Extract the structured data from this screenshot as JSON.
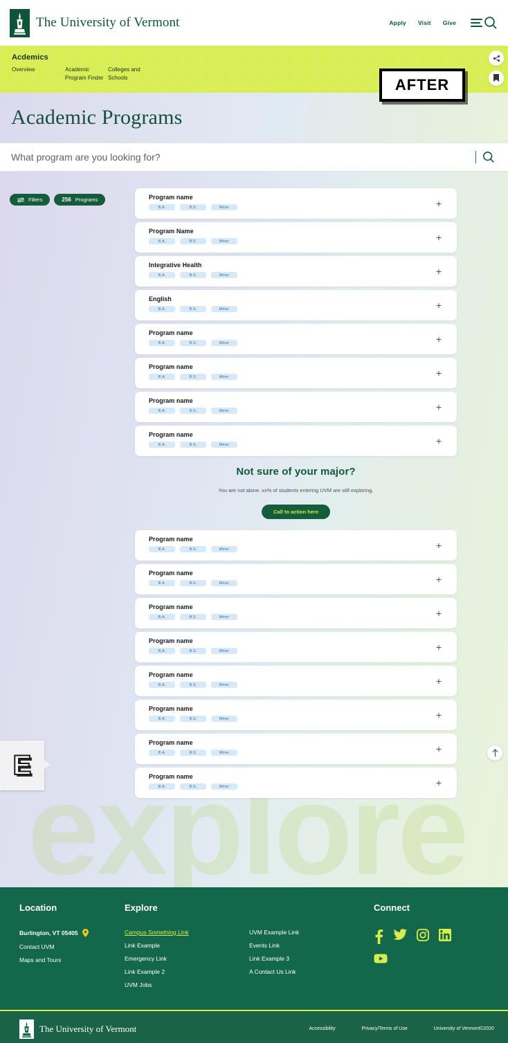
{
  "header": {
    "brand": "The University of Vermont",
    "nav": [
      {
        "label": "Apply"
      },
      {
        "label": "Visit"
      },
      {
        "label": "Give"
      }
    ],
    "menu_icon": "hamburger-icon",
    "search_icon": "search-icon"
  },
  "subnav": {
    "title": "Acdemics",
    "links": [
      {
        "label": "Overview"
      },
      {
        "label": "Academic Program Finder"
      },
      {
        "label": "Colleges and Schools"
      }
    ],
    "share_icon": "share-icon",
    "bookmark_icon": "bookmark-icon",
    "bg_color": "#d6ed4d"
  },
  "annotation": {
    "after_label": "AFTER",
    "comment_marker": "E"
  },
  "hero": {
    "title": "Academic Programs"
  },
  "search": {
    "placeholder": "What program are you looking for?",
    "value": "",
    "icon": "search-icon"
  },
  "toolbar": {
    "filters_label": "Filters",
    "filters_icon": "sliders-icon",
    "count": "256",
    "count_label": "Programs"
  },
  "watermark": "explore",
  "program_tags": [
    "B.A.",
    "B.S.",
    "Minor"
  ],
  "expand_icon": "plus-icon",
  "programs_top": [
    {
      "name": "Program name"
    },
    {
      "name": "Program Name"
    },
    {
      "name": "Integrative Health"
    },
    {
      "name": "English"
    },
    {
      "name": "Program name"
    },
    {
      "name": "Program name"
    },
    {
      "name": "Program name"
    },
    {
      "name": "Program name"
    }
  ],
  "cta": {
    "heading": "Not sure of your major?",
    "text": "You are not alone. xx% of students entering UVM are still exploring.",
    "button": "Call to action here",
    "button_bg": "#155c3c",
    "button_color": "#c9e84b"
  },
  "programs_bottom": [
    {
      "name": "Program name"
    },
    {
      "name": "Program name"
    },
    {
      "name": "Program name"
    },
    {
      "name": "Program name"
    },
    {
      "name": "Program name"
    },
    {
      "name": "Program name"
    },
    {
      "name": "Program name"
    },
    {
      "name": "Program name"
    }
  ],
  "back_to_top_icon": "arrow-up-icon",
  "footer": {
    "location": {
      "heading": "Location",
      "address": "Burlington, VT 05405",
      "pin_icon": "map-pin-icon",
      "links": [
        {
          "label": "Contact UVM"
        },
        {
          "label": "Maps and Tours"
        }
      ]
    },
    "explore": {
      "heading": "Explore",
      "links_col1": [
        {
          "label": "Campus Something Link",
          "highlight": true
        },
        {
          "label": "Link Example",
          "highlight": false
        },
        {
          "label": "Emergency Link",
          "highlight": false
        },
        {
          "label": "Link Example 2",
          "highlight": false
        },
        {
          "label": "UVM Jobs",
          "highlight": false
        }
      ],
      "links_col2": [
        {
          "label": "UVM Example Link"
        },
        {
          "label": "Events Link"
        },
        {
          "label": "Link Example 3"
        },
        {
          "label": "A Contact Us Link"
        }
      ]
    },
    "connect": {
      "heading": "Connect",
      "socials": [
        {
          "name": "facebook-icon"
        },
        {
          "name": "twitter-icon"
        },
        {
          "name": "instagram-icon"
        },
        {
          "name": "linkedin-icon"
        },
        {
          "name": "youtube-icon"
        }
      ]
    },
    "accent_color": "#d6ed4d",
    "bg_color": "#13674a"
  },
  "bottombar": {
    "brand": "The University of Vermont",
    "links": [
      {
        "label": "Accessibility"
      },
      {
        "label": "Privacy/Terms of Use"
      },
      {
        "label": "University of Vermont©2020"
      }
    ]
  }
}
